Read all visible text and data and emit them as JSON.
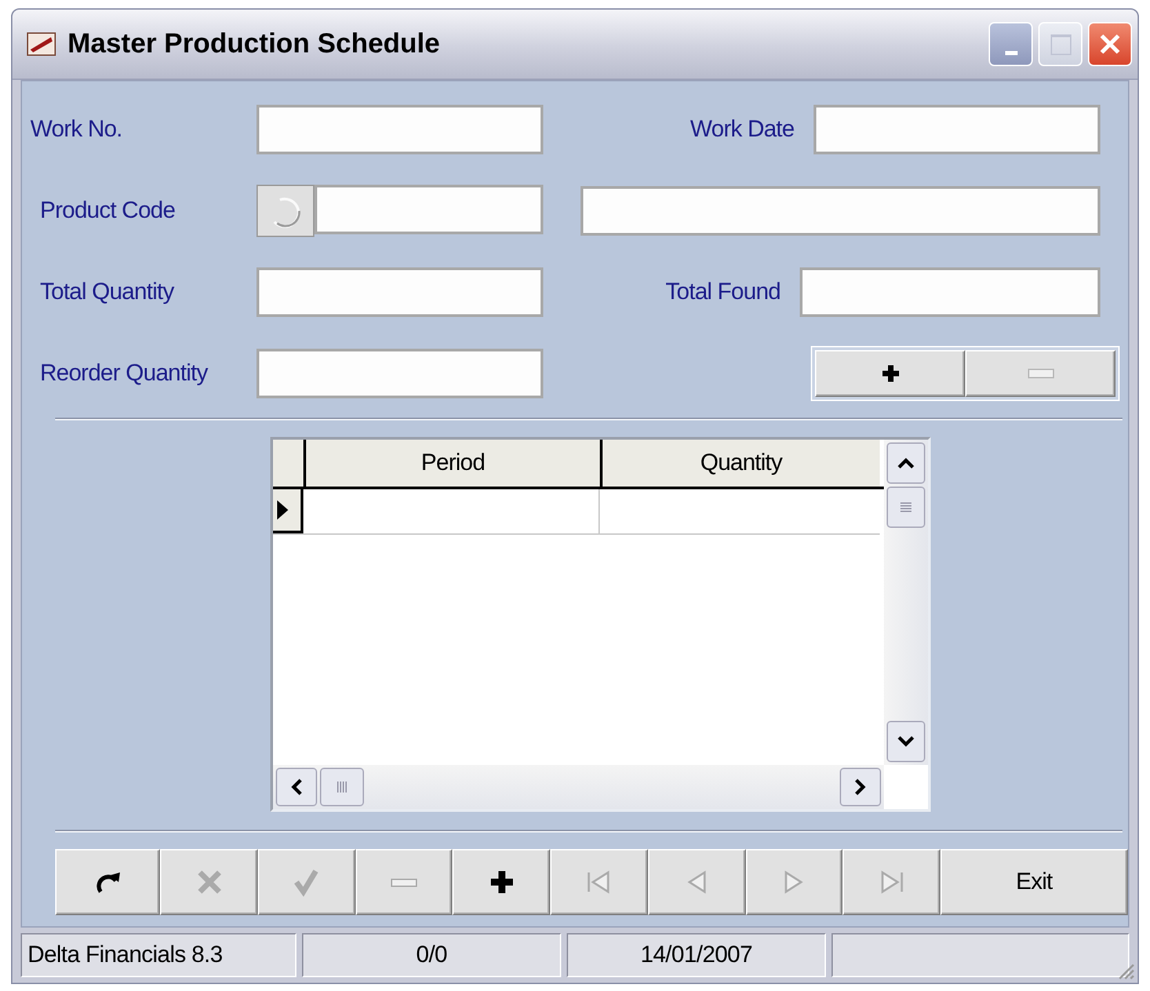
{
  "window": {
    "title": "Master Production Schedule"
  },
  "form": {
    "rows": [
      {
        "left": {
          "label": "Work No.",
          "kind": "plain"
        },
        "right": {
          "label": "Work Date",
          "kind": "plain"
        }
      },
      {
        "left": {
          "label": "Product Code",
          "kind": "lookup"
        },
        "right": {
          "kind": "wide"
        }
      },
      {
        "left": {
          "label": "Total Quantity",
          "kind": "plain"
        },
        "right": {
          "label": "Total Found",
          "kind": "plain"
        }
      },
      {
        "left": {
          "label": "Reorder Quantity",
          "kind": "plain"
        },
        "right": {
          "kind": "addremove"
        }
      }
    ]
  },
  "detail_buttons": [
    {
      "kind": "add",
      "disabled": false
    },
    {
      "kind": "remove",
      "disabled": true
    }
  ],
  "grid": {
    "columns": [
      "Period",
      "Quantity"
    ],
    "rows": [
      {
        "selected": true
      }
    ]
  },
  "toolbar": [
    {
      "kind": "refresh",
      "disabled": false
    },
    {
      "kind": "cancel",
      "disabled": true
    },
    {
      "kind": "confirm",
      "disabled": true
    },
    {
      "kind": "remove",
      "disabled": true
    },
    {
      "kind": "add",
      "disabled": false
    },
    {
      "kind": "first",
      "disabled": true
    },
    {
      "kind": "prev",
      "disabled": true
    },
    {
      "kind": "next",
      "disabled": true
    },
    {
      "kind": "last",
      "disabled": true
    },
    {
      "kind": "text",
      "label": "Exit"
    }
  ],
  "status_bar": [
    "Delta Financials 8.3",
    "0/0",
    "14/01/2007"
  ]
}
